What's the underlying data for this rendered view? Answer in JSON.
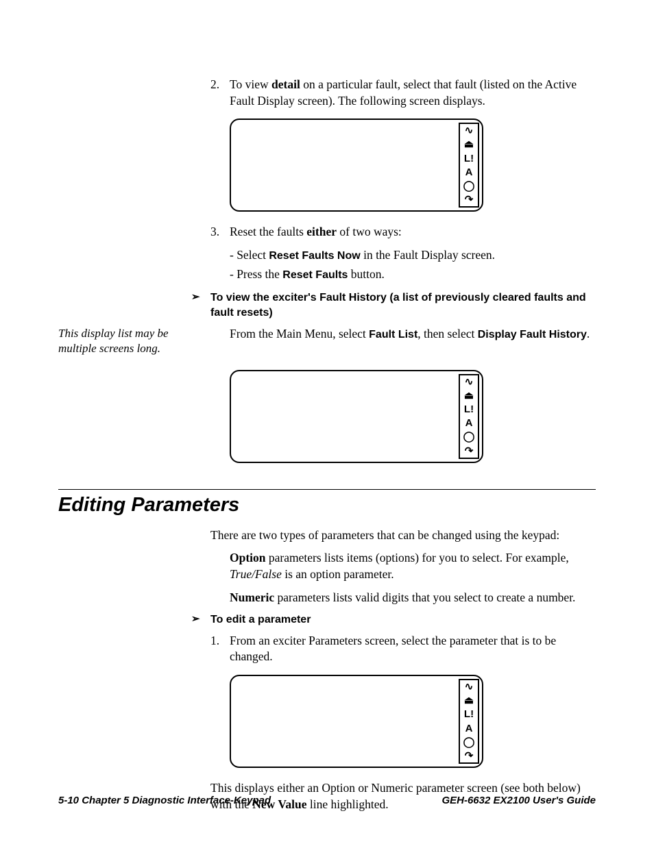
{
  "step2": {
    "num": "2.",
    "pre": "To view ",
    "bold": "detail",
    "post": " on a particular fault, select that fault (listed on the Active Fault Display screen). The following screen displays."
  },
  "step3": {
    "num": "3.",
    "pre": "Reset the faults ",
    "bold": "either",
    "post": " of two ways:",
    "sub1_pre": "- Select ",
    "sub1_bold": "Reset Faults Now",
    "sub1_post": " in the Fault Display screen.",
    "sub2_pre": "- Press the ",
    "sub2_bold": "Reset Faults",
    "sub2_post": " button."
  },
  "bullet1": {
    "mark": "➢",
    "text": "To view the exciter's Fault History (a list of previously cleared faults and fault resets)"
  },
  "history": {
    "pre": "From the Main Menu, select ",
    "b1": "Fault List",
    "mid": ", then select ",
    "b2": "Display Fault History",
    "post": "."
  },
  "marginNote": "This display list may be multiple screens long.",
  "section": "Editing Parameters",
  "intro": "There are two types of parameters that can be changed using the keypad:",
  "option": {
    "b": "Option",
    "t1": " parameters lists items (options) for you to select. For example, ",
    "i": "True/False",
    "t2": " is an option parameter."
  },
  "numeric": {
    "b": "Numeric",
    "t": " parameters lists valid digits that you select to create a number."
  },
  "bullet2": {
    "mark": "➢",
    "text": "To edit a parameter"
  },
  "edit1": {
    "num": "1.",
    "text": "From an exciter Parameters screen, select the parameter that is to be changed."
  },
  "closing": {
    "pre": "This displays either an Option or Numeric parameter screen (see both below) with the ",
    "b": "New Value",
    "post": " line highlighted."
  },
  "icons": {
    "i1": "∿",
    "i2": "⏏",
    "i3": "L!",
    "i4": "A",
    "i5": "◯",
    "i6": "↷"
  },
  "footer": {
    "left_page": "5-10",
    "left_chapter": "   Chapter 5  Diagnostic Interface-Keypad",
    "right": "GEH-6632  EX2100 User's Guide"
  }
}
